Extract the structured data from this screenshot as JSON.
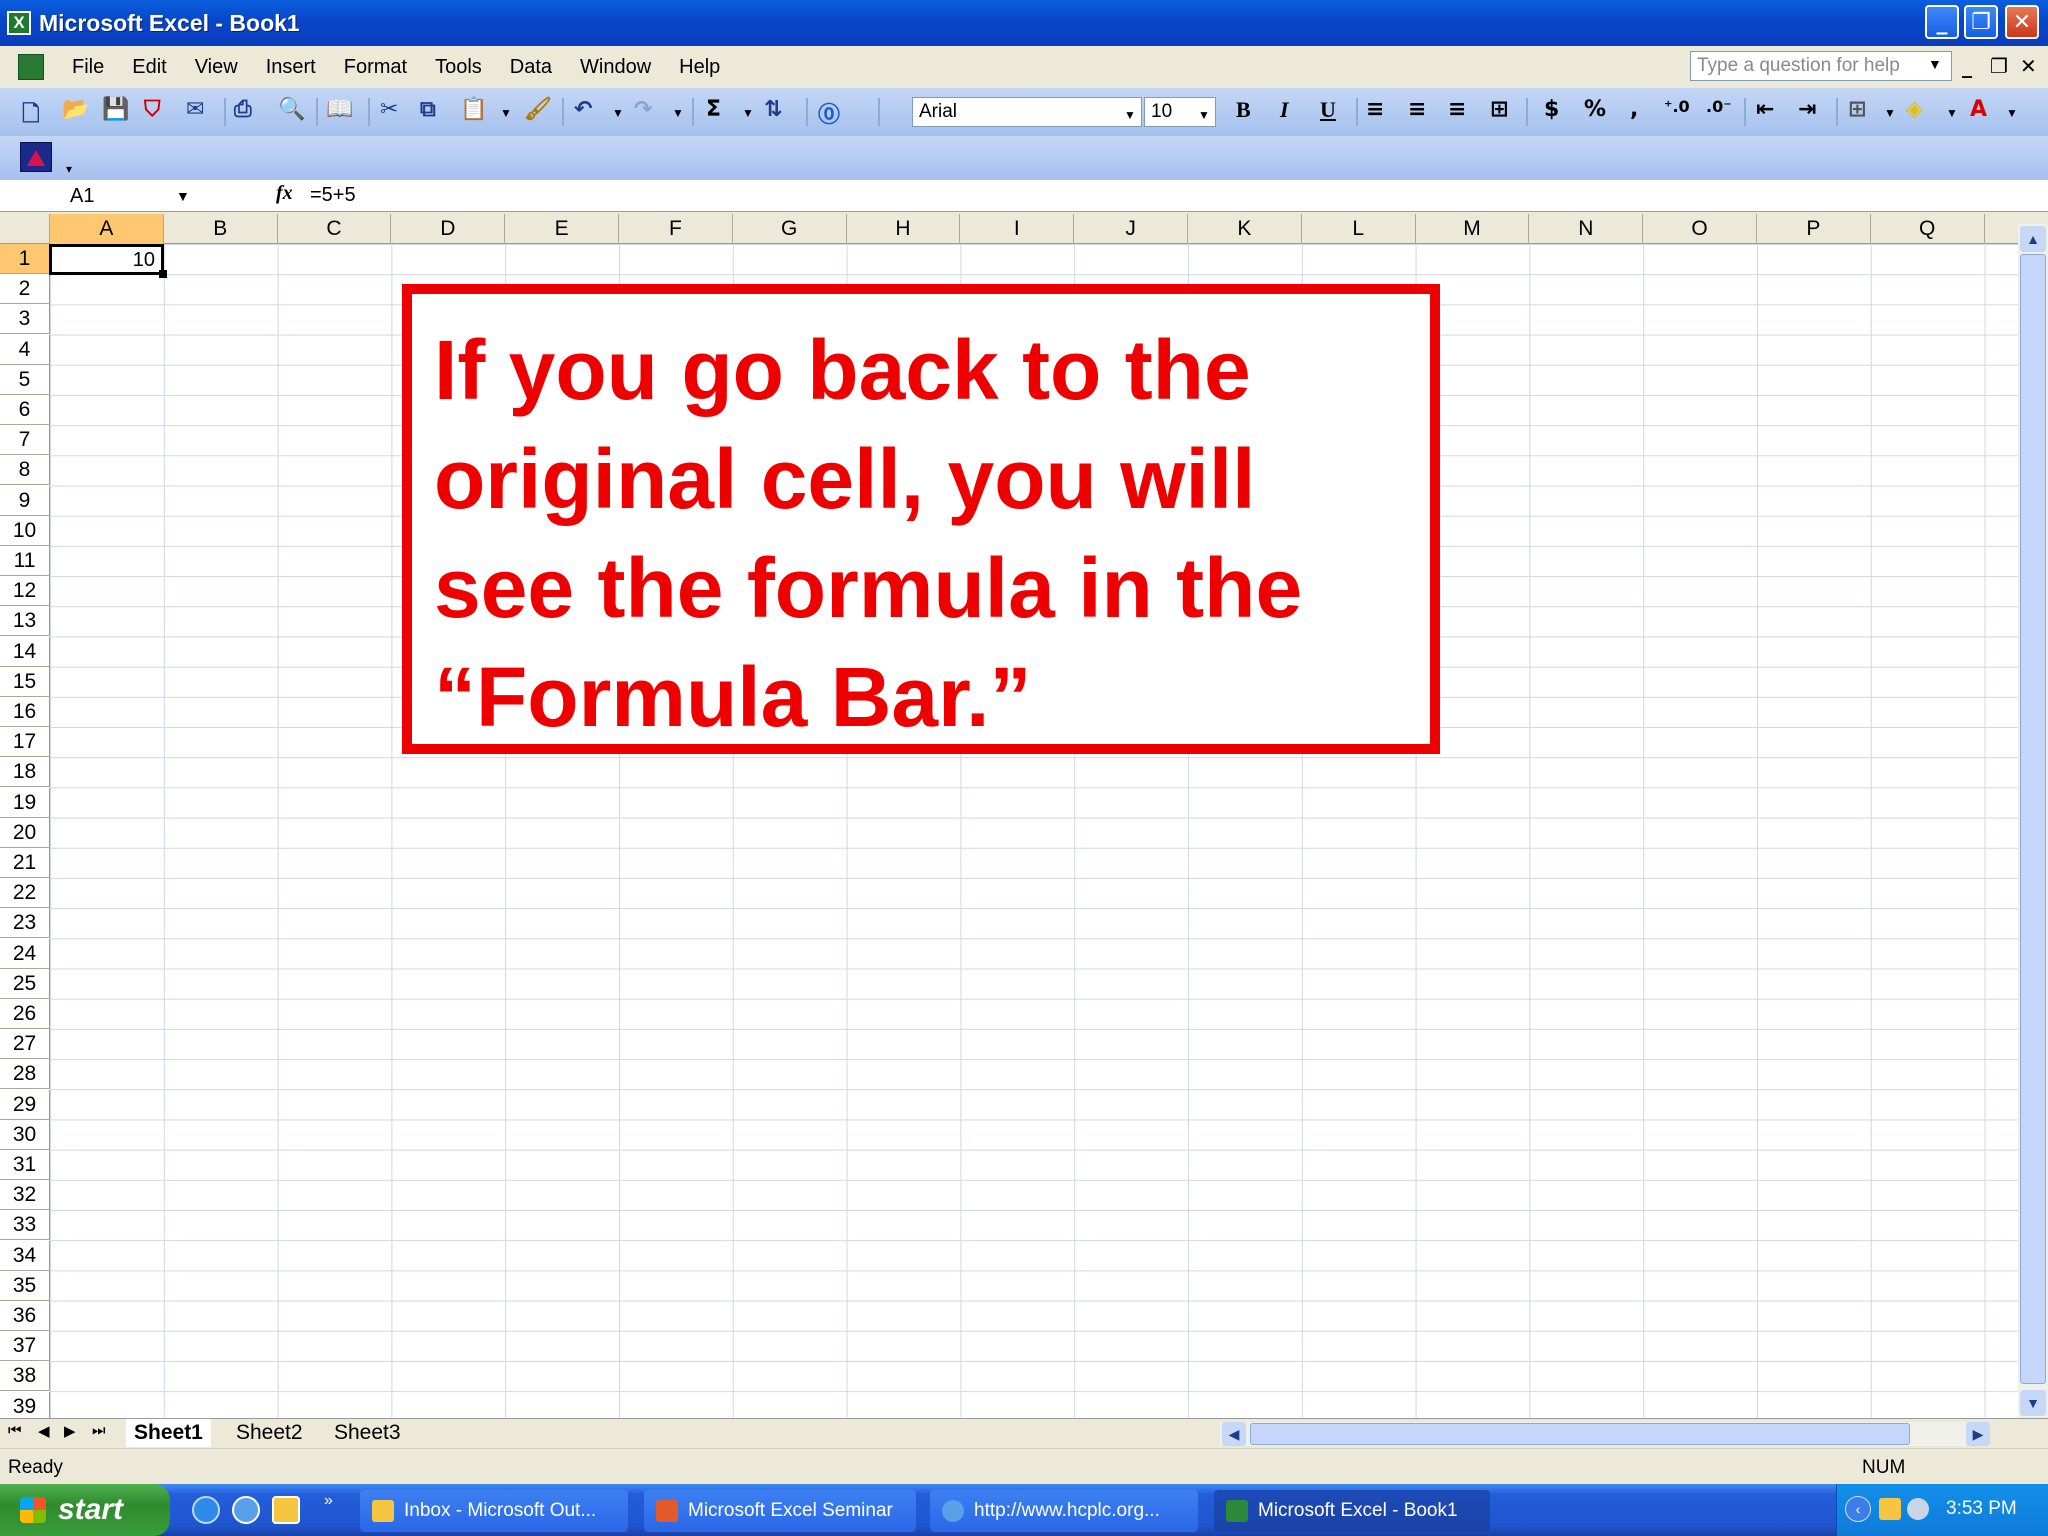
{
  "window": {
    "title": "Microsoft Excel - Book1",
    "buttons": {
      "minimize": "_",
      "maximize": "❐",
      "close": "✕"
    }
  },
  "menubar": {
    "items": [
      "File",
      "Edit",
      "View",
      "Insert",
      "Format",
      "Tools",
      "Data",
      "Window",
      "Help"
    ],
    "help_placeholder": "Type a question for help"
  },
  "formatting": {
    "font": "Arial",
    "size": "10",
    "bold": "B",
    "italic": "I",
    "underline": "U",
    "currency": "$",
    "percent": "%",
    "comma": ","
  },
  "formula_bar": {
    "name_box": "A1",
    "fx": "fx",
    "formula": "=5+5"
  },
  "sheet": {
    "columns": [
      "A",
      "B",
      "C",
      "D",
      "E",
      "F",
      "G",
      "H",
      "I",
      "J",
      "K",
      "L",
      "M",
      "N",
      "O",
      "P",
      "Q"
    ],
    "rows": [
      "1",
      "2",
      "3",
      "4",
      "5",
      "6",
      "7",
      "8",
      "9",
      "10",
      "11",
      "12",
      "13",
      "14",
      "15",
      "16",
      "17",
      "18",
      "19",
      "20",
      "21",
      "22",
      "23",
      "24",
      "25",
      "26",
      "27",
      "28",
      "29",
      "30",
      "31",
      "32",
      "33",
      "34",
      "35",
      "36",
      "37",
      "38",
      "39"
    ],
    "active_column": "A",
    "active_row": "1",
    "cell_a1_value": "10"
  },
  "callout": {
    "lines": [
      "If you go back to the",
      "original cell, you will",
      "see the formula in the",
      "“Formula Bar.”"
    ],
    "color": "#ee0000"
  },
  "tabs": {
    "sheets": [
      "Sheet1",
      "Sheet2",
      "Sheet3"
    ],
    "active": "Sheet1"
  },
  "statusbar": {
    "text": "Ready",
    "num": "NUM"
  },
  "taskbar": {
    "start_label": "start",
    "tasks": [
      {
        "label": "Inbox - Microsoft Out..."
      },
      {
        "label": "Microsoft Excel Seminar"
      },
      {
        "label": "http://www.hcplc.org..."
      },
      {
        "label": "Microsoft Excel - Book1"
      }
    ],
    "clock": "3:53 PM"
  }
}
